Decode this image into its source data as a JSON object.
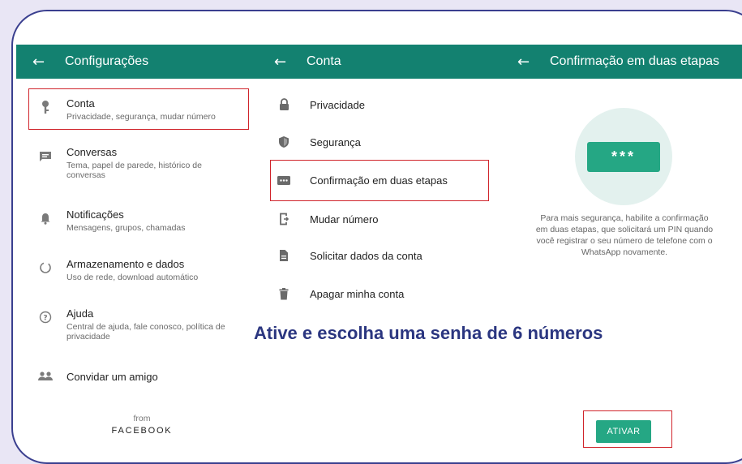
{
  "settings": {
    "title": "Configurações",
    "items": [
      {
        "label": "Conta",
        "desc": "Privacidade, segurança, mudar número",
        "icon": "key-icon"
      },
      {
        "label": "Conversas",
        "desc": "Tema, papel de parede, histórico de conversas",
        "icon": "chat-icon"
      },
      {
        "label": "Notificações",
        "desc": "Mensagens, grupos, chamadas",
        "icon": "bell-icon"
      },
      {
        "label": "Armazenamento e dados",
        "desc": "Uso de rede, download automático",
        "icon": "data-usage-icon"
      },
      {
        "label": "Ajuda",
        "desc": "Central de ajuda, fale conosco, política de privacidade",
        "icon": "help-icon"
      },
      {
        "label": "Convidar um amigo",
        "desc": "",
        "icon": "people-icon"
      }
    ],
    "from": "from",
    "brand": "FACEBOOK"
  },
  "account": {
    "title": "Conta",
    "items": [
      {
        "label": "Privacidade",
        "icon": "lock-icon"
      },
      {
        "label": "Segurança",
        "icon": "shield-icon"
      },
      {
        "label": "Confirmação em duas etapas",
        "icon": "dots-icon"
      },
      {
        "label": "Mudar número",
        "icon": "phone-change-icon"
      },
      {
        "label": "Solicitar dados da conta",
        "icon": "document-icon"
      },
      {
        "label": "Apagar minha conta",
        "icon": "trash-icon"
      }
    ]
  },
  "twostep": {
    "title": "Confirmação em duas etapas",
    "pin_mask": "***",
    "description_lines": [
      "Para mais segurança, habilite a confirmação",
      "em duas etapas, que solicitará um PIN quando",
      "você registrar o seu número de telefone com o",
      "WhatsApp novamente."
    ],
    "button_label": "ATIVAR"
  },
  "caption": "Ative e escolha uma senha de 6 números",
  "colors": {
    "header": "#138170",
    "accent": "#25a784",
    "highlight": "#d0242b",
    "caption": "#2b3680",
    "frame": "#3a3f8f"
  }
}
